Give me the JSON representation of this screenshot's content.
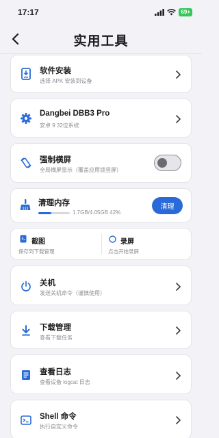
{
  "status_bar": {
    "time": "17:17",
    "battery": "69+"
  },
  "nav": {
    "title": "实用工具"
  },
  "colors": {
    "accent": "#2a6ad8",
    "background": "#f2f2f7",
    "battery": "#34c759"
  },
  "items": {
    "software_install": {
      "title": "软件安装",
      "subtitle": "选择 APK 安装到设备",
      "icon": "install-phone-icon"
    },
    "device_info": {
      "title": "Dangbei DBB3 Pro",
      "subtitle": "安卓 9 32位系统",
      "icon": "gear-icon"
    },
    "force_landscape": {
      "title": "强制横屏",
      "subtitle": "全局横屏显示（覆盖应用锁竖屏）",
      "icon": "rotate-screen-icon",
      "enabled": false
    },
    "clear_memory": {
      "title": "清理内存",
      "usage": "1.7GB/4.05GB 42%",
      "progress": 0.42,
      "button": "清理",
      "icon": "broom-icon"
    },
    "screenshot": {
      "title": "截图",
      "subtitle": "保存到下载管理",
      "icon": "screenshot-icon"
    },
    "record": {
      "title": "录屏",
      "subtitle": "点击开始录屏",
      "icon": "record-circle-icon"
    },
    "shutdown": {
      "title": "关机",
      "subtitle": "发送关机命令（谨慎使用）",
      "icon": "power-icon"
    },
    "downloads": {
      "title": "下载管理",
      "subtitle": "查看下载任务",
      "icon": "download-icon"
    },
    "logs": {
      "title": "查看日志",
      "subtitle": "查看设备 logcat 日志",
      "icon": "log-icon"
    },
    "shell": {
      "title": "Shell 命令",
      "subtitle": "执行自定义命令",
      "icon": "terminal-icon"
    }
  }
}
